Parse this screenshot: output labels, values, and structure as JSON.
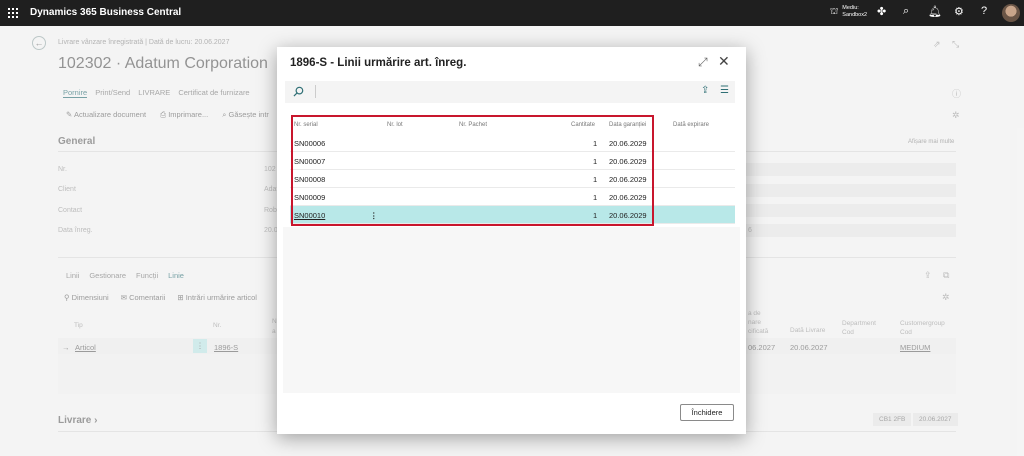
{
  "topbar": {
    "app_title": "Dynamics 365 Business Central",
    "environment_line1": "Mediu:",
    "environment_line2": "Sandbox2",
    "icons": [
      "waffle-icon",
      "copilot-icon",
      "search-icon",
      "bell-icon",
      "gear-icon",
      "help-icon",
      "avatar"
    ]
  },
  "background_page": {
    "breadcrumb": "Livrare vânzare înregistrată | Dată de lucru: 20.06.2027",
    "title": "102302 · Adatum Corporation",
    "tabs": [
      "Pornire",
      "Print/Send",
      "LIVRARE",
      "Certificat de furnizare"
    ],
    "actions": [
      "Actualizare document",
      "Imprimare...",
      "Găsește intr"
    ],
    "general": {
      "heading": "General",
      "show_more": "Afișare mai multe",
      "fields": [
        {
          "label": "Nr.",
          "value": "102"
        },
        {
          "label": "Client",
          "value": "Adat"
        },
        {
          "label": "Contact",
          "value": "Rob"
        },
        {
          "label": "Data înreg.",
          "value": "20.0"
        }
      ],
      "right_partial_value": "6"
    },
    "lines": {
      "tabs": [
        "Linii",
        "Gestionare",
        "Funcții",
        "Linie"
      ],
      "actions": [
        "Dimensiuni",
        "Comentarii",
        "Intrări urmărire articol"
      ],
      "headers": [
        "Tip",
        "Nr.",
        "N",
        "a",
        "a de",
        "nare",
        "cificată",
        "Dată Livrare",
        "Department",
        "Cod",
        "Customergroup",
        "Cod"
      ],
      "row": {
        "type": "Articol",
        "no": "1896-S",
        "date1": "06.2027",
        "date2": "20.06.2027",
        "group": "MEDIUM"
      }
    },
    "livrare": {
      "heading": "Livrare",
      "chips": [
        "CB1 2FB",
        "20.06.2027"
      ]
    }
  },
  "dialog": {
    "title": "1896-S - Linii urmărire art. înreg.",
    "columns": {
      "serial": "Nr. serial",
      "lot": "Nr. lot",
      "package": "Nr. Pachet",
      "quantity": "Cantitate",
      "warranty": "Data garanției",
      "expiry": "Dată expirare"
    },
    "rows": [
      {
        "serial": "SN00006",
        "quantity": "1",
        "warranty": "20.06.2029"
      },
      {
        "serial": "SN00007",
        "quantity": "1",
        "warranty": "20.06.2029"
      },
      {
        "serial": "SN00008",
        "quantity": "1",
        "warranty": "20.06.2029"
      },
      {
        "serial": "SN00009",
        "quantity": "1",
        "warranty": "20.06.2029"
      },
      {
        "serial": "SN00010",
        "quantity": "1",
        "warranty": "20.06.2029"
      }
    ],
    "kebab": "⋮",
    "close_button": "Închidere",
    "highlight_color": "#c8162d",
    "selected_row_color": "#b8e8e8"
  }
}
